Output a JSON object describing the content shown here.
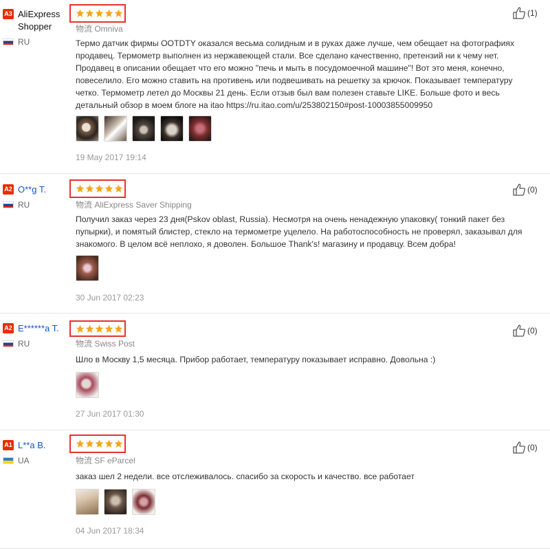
{
  "reviews": [
    {
      "level": "A3",
      "name": "AliExpress Shopper",
      "country": "RU",
      "shipping": "物流 Omniva",
      "text": "Термо датчик фирмы OOTDTY оказался весьма солидным и в руках даже лучше, чем обещает на фотографиях продавец. Термометр выполнен из нержавеющей стали. Все сделано качественно, претензий ни к чему нет. Продавец в описании обещает что его можно \"печь и мыть в посудомоечной машине\"! Вот это меня, конечно, повеселило. Его можно ставить на противень или подвешивать на решетку за крючок. Показывает температуру четко. Термометр летел до Москвы 21 день. Если отзыв был вам полезен ставьте LIKE. Больше фото и весь детальный обзор в моем блоге на itao https://ru.itao.com/u/253802150#post-10003855009950",
      "date": "19 May 2017 19:14",
      "helpful": "(1)",
      "rating": 5
    },
    {
      "level": "A2",
      "name": "O**g T.",
      "country": "RU",
      "shipping": "物流 AliExpress Saver Shipping",
      "text": "Получил заказ через 23 дня(Pskov oblast, Russia). Несмотря на очень ненадежную упаковку( тонкий пакет без пупырки), и помятый блистер, стекло на термометре уцелело. На работоспособность не проверял, заказывал для знакомого. В целом всё неплохо, я доволен. Большое Thank's! магазину и продавцу. Всем добра!",
      "date": "30 Jun 2017 02:23",
      "helpful": "(0)",
      "rating": 5
    },
    {
      "level": "A2",
      "name": "E******a T.",
      "country": "RU",
      "shipping": "物流 Swiss Post",
      "text": "Шло в Москву 1,5 месяца. Прибор работает, температуру показывает исправно. Довольна :)",
      "date": "27 Jun 2017 01:30",
      "helpful": "(0)",
      "rating": 5
    },
    {
      "level": "A1",
      "name": "L**a B.",
      "country": "UA",
      "shipping": "物流 SF eParcel",
      "text": "заказ шел 2 недели. все отслеживалось. спасибо за скорость и качество. все работает",
      "date": "04 Jun 2017 18:34",
      "helpful": "(0)",
      "rating": 5
    }
  ],
  "colors": {
    "accent_red": "#e5322d",
    "star": "#f5a51c",
    "level_badge": "#e62e04",
    "link_blue": "#1155cc"
  },
  "icons": {
    "star": "star-icon",
    "helpful": "thumbs-up-icon",
    "flag_ru": "russia-flag-icon",
    "flag_ua": "ukraine-flag-icon"
  }
}
